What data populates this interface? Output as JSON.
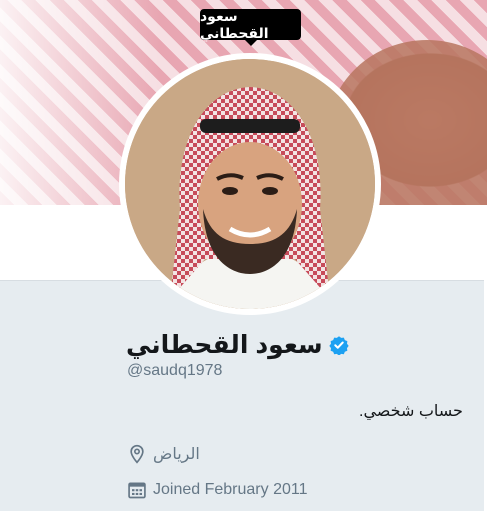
{
  "tooltip": {
    "text": "سعود القحطاني"
  },
  "profile": {
    "display_name": "سعود القحطاني",
    "handle": "@saudq1978",
    "bio": "حساب شخصي.",
    "location": "الرياض",
    "joined": "Joined February 2011",
    "verified_color": "#1da1f2"
  },
  "icons": {
    "verified": "verified-badge-icon",
    "location": "location-pin-icon",
    "calendar": "calendar-icon"
  }
}
